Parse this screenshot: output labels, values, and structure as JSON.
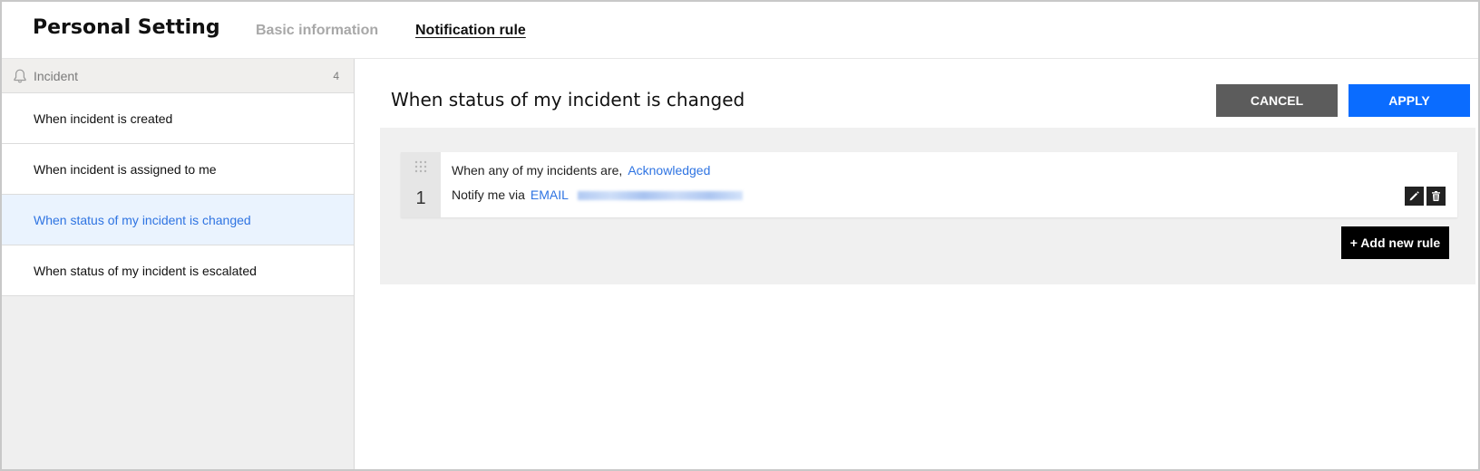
{
  "header": {
    "title": "Personal Setting",
    "tabs": [
      {
        "label": "Basic information"
      },
      {
        "label": "Notification rule"
      }
    ]
  },
  "sidebar": {
    "section_icon": "bell-icon",
    "section_title": "Incident",
    "section_count": "4",
    "items": [
      {
        "label": "When incident is created"
      },
      {
        "label": "When incident is assigned to me"
      },
      {
        "label": "When status of my incident is changed"
      },
      {
        "label": "When status of my incident is escalated"
      }
    ]
  },
  "main": {
    "title": "When status of my incident is changed",
    "cancel_label": "CANCEL",
    "apply_label": "APPLY",
    "rules": [
      {
        "number": "1",
        "condition_prefix": "When any of my incidents are,",
        "condition_value": "Acknowledged",
        "notify_prefix": "Notify me via",
        "notify_channel": "EMAIL"
      }
    ],
    "add_rule_label": "+ Add new rule"
  },
  "colors": {
    "accent": "#0a6cff",
    "link": "#2f74e2",
    "active_row_bg": "#eaf3fe",
    "cancel_bg": "#5c5c5c"
  }
}
